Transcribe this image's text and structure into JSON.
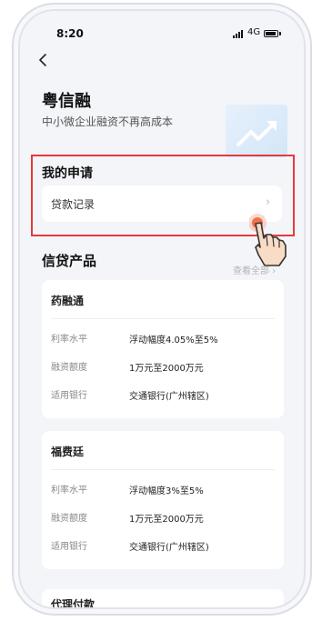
{
  "status_bar": {
    "time": "8:20",
    "network": "4G"
  },
  "header": {
    "title": "粤信融",
    "subtitle": "中小微企业融资不再高成本"
  },
  "application_section": {
    "heading": "我的申请",
    "loan_records_label": "贷款记录"
  },
  "products_section": {
    "heading": "信贷产品",
    "view_all_label": "查看全部",
    "products": [
      {
        "name": "药融通",
        "rows": [
          {
            "label": "利率水平",
            "value": "浮动幅度4.05%至5%"
          },
          {
            "label": "融资额度",
            "value": "1万元至2000万元"
          },
          {
            "label": "适用银行",
            "value": "交通银行(广州辖区)"
          }
        ]
      },
      {
        "name": "福费廷",
        "rows": [
          {
            "label": "利率水平",
            "value": "浮动幅度3%至5%"
          },
          {
            "label": "融资额度",
            "value": "1万元至2000万元"
          },
          {
            "label": "适用银行",
            "value": "交通银行(广州辖区)"
          }
        ]
      }
    ],
    "partial_next_product": "代理付款"
  },
  "icons": [
    "back-arrow-icon",
    "signal-icon",
    "battery-icon",
    "trend-chart-icon",
    "chevron-right-icon",
    "pointing-hand-icon"
  ],
  "colors": {
    "highlight": "#e33b3b",
    "hero": "#d3e6f8",
    "tap": "#f0643c"
  }
}
